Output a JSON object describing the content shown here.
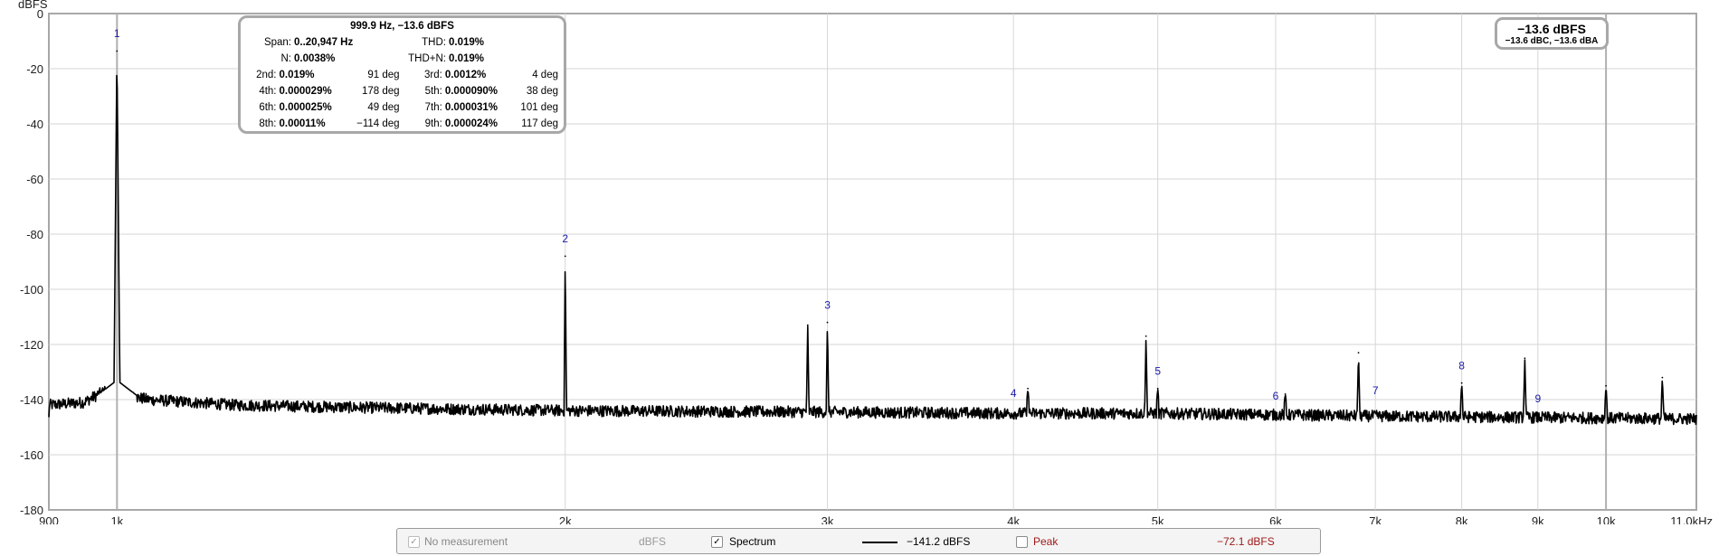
{
  "colors": {
    "spectrum": "#000000",
    "harmonic_marker": "#1a1aa8",
    "grid": "#d6d6d6",
    "axis": "#a8a8a8",
    "peak": "#a01a1a"
  },
  "chart_data": {
    "type": "line",
    "title": "",
    "xlabel": "",
    "ylabel": "dBFS",
    "x_scale": "log",
    "xlim": [
      900,
      11500
    ],
    "ylim": [
      -180,
      0
    ],
    "grid": true,
    "y_ticks": [
      0,
      -20,
      -40,
      -60,
      -80,
      -100,
      -120,
      -140,
      -160,
      -180
    ],
    "y_tick_labels": [
      "0",
      "-20",
      "-40",
      "-60",
      "-80",
      "-100",
      "-120",
      "-140",
      "-160",
      "-180"
    ],
    "x_ticks": [
      900,
      1000,
      2000,
      3000,
      4000,
      5000,
      6000,
      7000,
      8000,
      9000,
      10000
    ],
    "x_tick_labels": [
      "900",
      "1k",
      "2k",
      "3k",
      "4k",
      "5k",
      "6k",
      "7k",
      "8k",
      "9k",
      "10k"
    ],
    "x_end_label": "11.0kHz",
    "x_major_gridlines": [
      1000,
      10000
    ],
    "noise_floor": [
      [
        900,
        -142
      ],
      [
        950,
        -141
      ],
      [
        980,
        -137
      ],
      [
        1050,
        -140
      ],
      [
        1200,
        -142
      ],
      [
        1500,
        -143
      ],
      [
        2000,
        -144
      ],
      [
        3000,
        -144.5
      ],
      [
        4000,
        -145
      ],
      [
        5000,
        -145
      ],
      [
        6000,
        -145.5
      ],
      [
        7000,
        -146
      ],
      [
        9000,
        -146.5
      ],
      [
        11500,
        -147
      ]
    ],
    "peaks": [
      {
        "x": 999.9,
        "y": -13.6
      },
      {
        "x": 2000,
        "y": -88
      },
      {
        "x": 2910,
        "y": -113
      },
      {
        "x": 3000,
        "y": -112
      },
      {
        "x": 4090,
        "y": -136
      },
      {
        "x": 4910,
        "y": -117
      },
      {
        "x": 5000,
        "y": -136
      },
      {
        "x": 6090,
        "y": -138
      },
      {
        "x": 6820,
        "y": -123
      },
      {
        "x": 8000,
        "y": -134
      },
      {
        "x": 8820,
        "y": -125
      },
      {
        "x": 10000,
        "y": -135
      },
      {
        "x": 10910,
        "y": -132
      }
    ],
    "harmonic_labels": [
      {
        "label": "1",
        "x": 999.9,
        "y": -8.5
      },
      {
        "label": "2",
        "x": 2000,
        "y": -83
      },
      {
        "label": "3",
        "x": 3000,
        "y": -107
      },
      {
        "label": "4",
        "x": 4000,
        "y": -139
      },
      {
        "label": "5",
        "x": 5000,
        "y": -131
      },
      {
        "label": "6",
        "x": 6000,
        "y": -140
      },
      {
        "label": "7",
        "x": 7000,
        "y": -138
      },
      {
        "label": "8",
        "x": 8000,
        "y": -129
      },
      {
        "label": "9",
        "x": 9000,
        "y": -141
      }
    ]
  },
  "info": {
    "title": "999.9 Hz, −13.6 dBFS",
    "span_label": "Span:",
    "span_value": "0..20,947 Hz",
    "thd_label": "THD:",
    "thd_value": "0.019%",
    "n_label": "N:",
    "n_value": "0.0038%",
    "thdn_label": "THD+N:",
    "thdn_value": "0.019%",
    "harmonics": [
      {
        "label": "2nd:",
        "value": "0.019%",
        "deg": "91 deg",
        "label2": "3rd:",
        "value2": "0.0012%",
        "deg2": "4 deg"
      },
      {
        "label": "4th:",
        "value": "0.000029%",
        "deg": "178 deg",
        "label2": "5th:",
        "value2": "0.000090%",
        "deg2": "38 deg"
      },
      {
        "label": "6th:",
        "value": "0.000025%",
        "deg": "49 deg",
        "label2": "7th:",
        "value2": "0.000031%",
        "deg2": "101 deg"
      },
      {
        "label": "8th:",
        "value": "0.00011%",
        "deg": "−114 deg",
        "label2": "9th:",
        "value2": "0.000024%",
        "deg2": "117 deg"
      }
    ]
  },
  "level": {
    "main": "−13.6 dBFS",
    "sub": "−13.6 dBC, −13.6 dBA"
  },
  "legend": {
    "no_measurement_label": "No measurement",
    "no_measurement_unit": "dBFS",
    "spectrum_label": "Spectrum",
    "spectrum_value": "−141.2 dBFS",
    "peak_label": "Peak",
    "peak_value": "−72.1 dBFS",
    "no_measurement_checked": true,
    "spectrum_checked": true,
    "peak_checked": false
  }
}
